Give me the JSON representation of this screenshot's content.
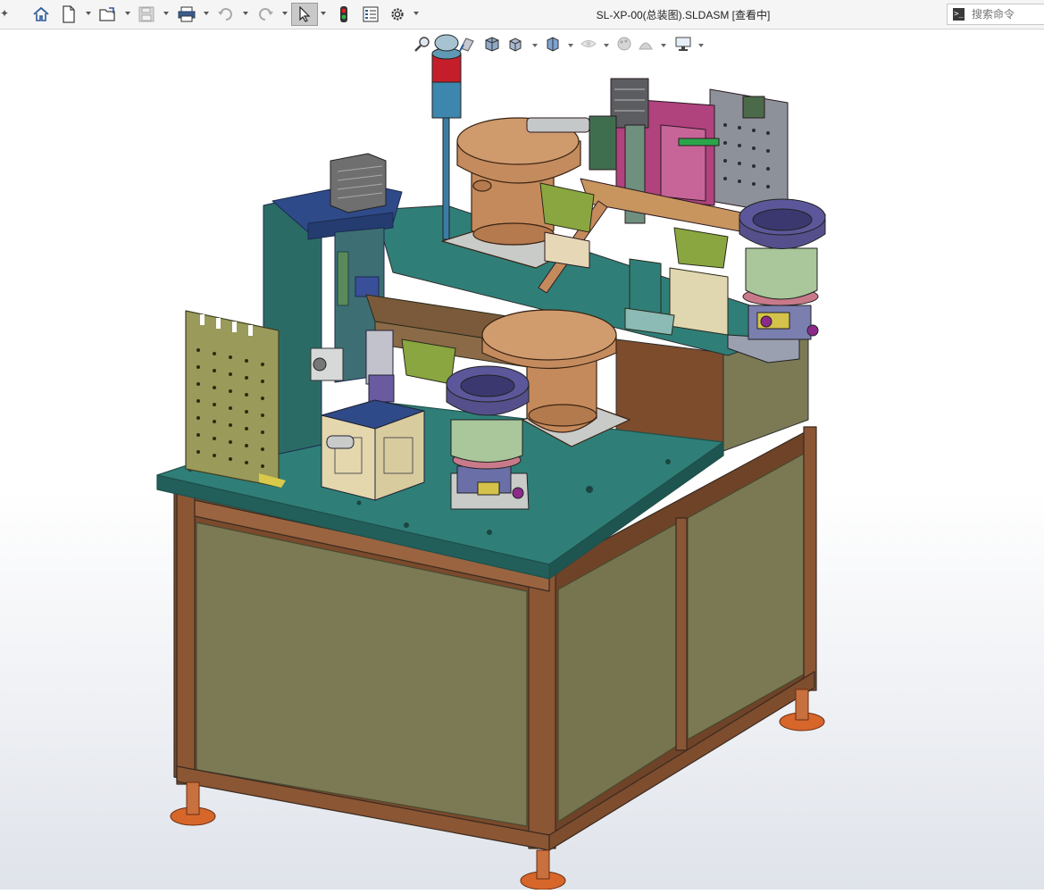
{
  "window": {
    "title": "SL-XP-00(总装图).SLDASM [查看中]"
  },
  "search": {
    "placeholder": "搜索命令"
  },
  "toolbar": {
    "items": [
      "home-icon",
      "new-document-icon",
      "open-folder-icon",
      "save-icon",
      "print-icon",
      "undo-icon",
      "redo-icon",
      "select-arrow-icon",
      "rebuild-traffic-light-icon",
      "file-properties-icon",
      "options-gear-icon"
    ]
  },
  "heads_up_toolbar": {
    "items": [
      "zoom-to-fit-icon",
      "zoom-to-area-icon",
      "previous-view-icon",
      "section-view-icon",
      "view-orientation-icon",
      "display-style-icon",
      "hide-show-items-icon",
      "edit-appearance-icon",
      "apply-scene-icon",
      "view-settings-icon"
    ]
  },
  "colors": {
    "table_top": "#2f7f78",
    "frame": "#7a4a2c",
    "panel": "#7b7a55",
    "bowl_brown": "#c58a5c",
    "feeder_purple": "#55508c",
    "feeder_green": "#a9c79a",
    "cylinder_navy": "#2f4a88",
    "magenta_block": "#b0427e",
    "olive_plate": "#9a9a5a",
    "foot_orange": "#d7662b",
    "signal_red": "#c41e2a",
    "signal_blue": "#3a7ca6"
  }
}
